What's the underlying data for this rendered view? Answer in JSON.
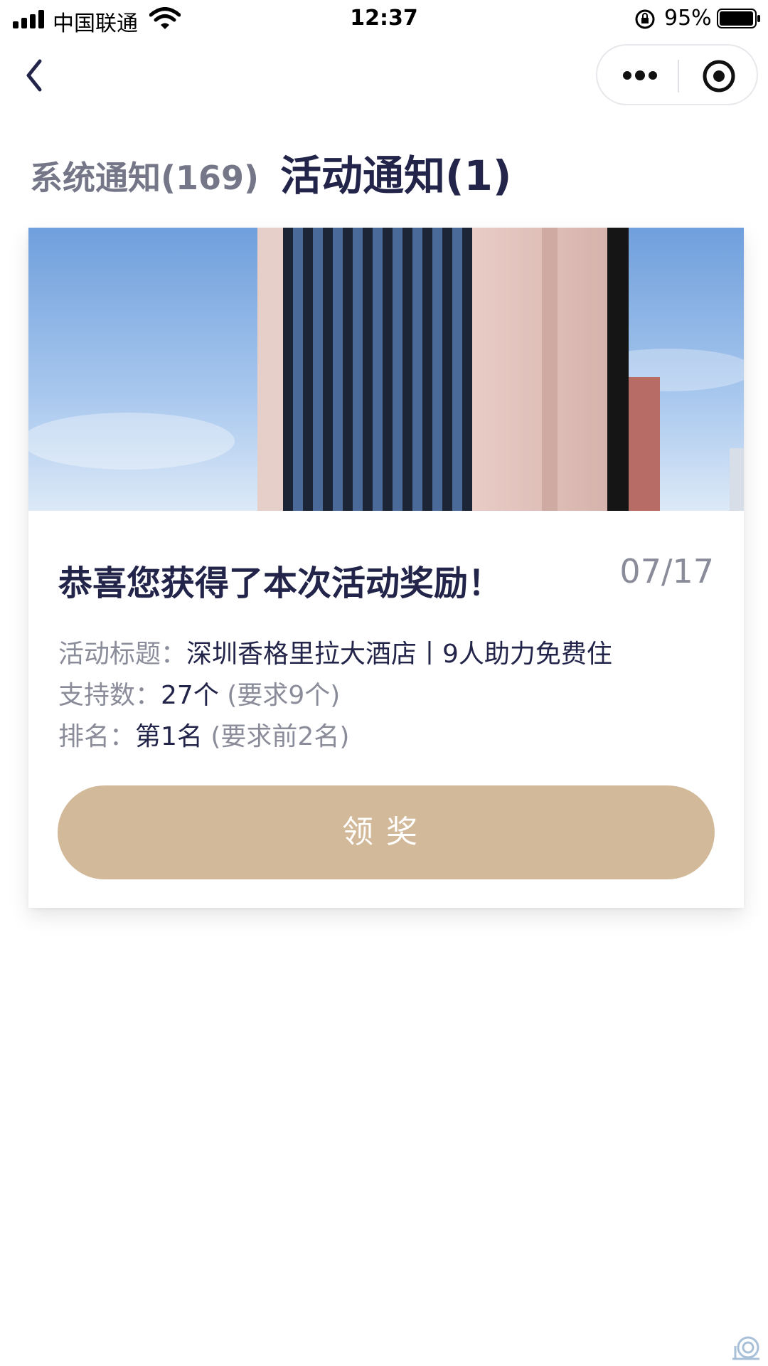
{
  "status_bar": {
    "carrier": "中国联通",
    "time": "12:37",
    "battery": "95%"
  },
  "nav": {
    "back_icon": "chevron-left-icon",
    "more_icon": "more-dots-icon",
    "close_icon": "target-circle-icon"
  },
  "tabs": [
    {
      "label": "系统通知(169)",
      "active": false
    },
    {
      "label": "活动通知(1)",
      "active": true
    }
  ],
  "card": {
    "title": "恭喜您获得了本次活动奖励！",
    "date": "07/17",
    "activity_label": "活动标题：",
    "activity_value": "深圳香格里拉大酒店丨9人助力免费住",
    "support_label": "支持数：",
    "support_value": "27个",
    "support_note": "(要求9个)",
    "rank_label": "排名：",
    "rank_value": "第1名",
    "rank_note": "(要求前2名)",
    "button_label": "领奖"
  },
  "colors": {
    "primary_text": "#22244a",
    "secondary_text": "#8a8c9a",
    "button": "#d2b999"
  }
}
